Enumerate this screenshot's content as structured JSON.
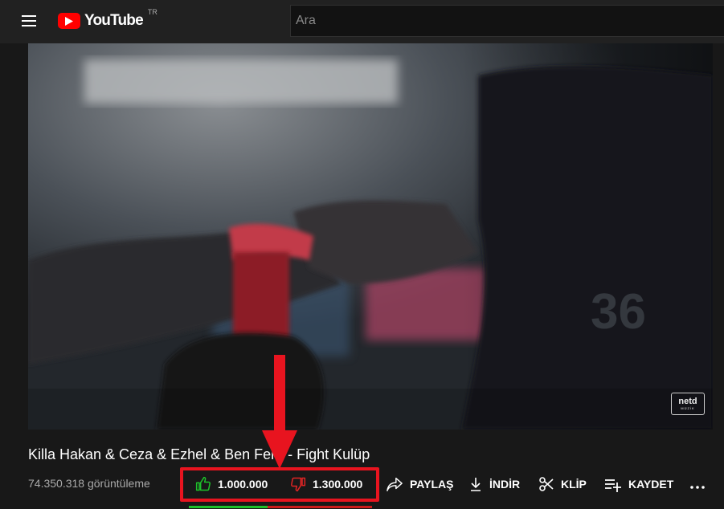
{
  "header": {
    "menu_icon": "hamburger-menu-icon",
    "logo_text": "YouTube",
    "country_code": "TR",
    "search_placeholder": "Ara"
  },
  "player": {
    "watermark_top": "netd",
    "watermark_bottom": "MÜZİK",
    "shirt_number": "36"
  },
  "video": {
    "title": "Killa Hakan & Ceza & Ezhel & Ben Fero - Fight Kulüp",
    "views": "74.350.318 görüntüleme"
  },
  "actions": {
    "like_count": "1.000.000",
    "dislike_count": "1.300.000",
    "share_label": "PAYLAŞ",
    "download_label": "İNDİR",
    "clip_label": "KLİP",
    "save_label": "KAYDET",
    "more_icon": "more-horizontal-icon"
  },
  "sentiment": {
    "like_fraction": 0.43
  },
  "colors": {
    "like_green": "#1ec12a",
    "dislike_red": "#cc1b1b",
    "highlight_red": "#e8141f",
    "brand_red": "#ff0000",
    "page_bg": "#181818",
    "topbar_bg": "#212121"
  }
}
